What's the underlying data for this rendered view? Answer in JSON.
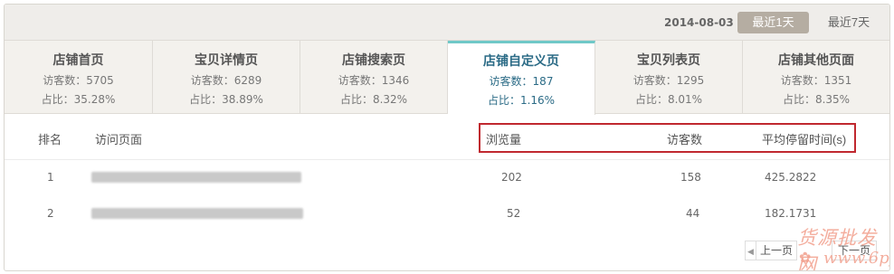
{
  "toolbar": {
    "date": "2014-08-03",
    "range_1day": "最近1天",
    "range_7day": "最近7天"
  },
  "tabs": [
    {
      "label": "店铺首页",
      "visitors": "访客数：5705",
      "ratio": "占比：35.28%",
      "active": false
    },
    {
      "label": "宝贝详情页",
      "visitors": "访客数：6289",
      "ratio": "占比：38.89%",
      "active": false
    },
    {
      "label": "店铺搜索页",
      "visitors": "访客数：1346",
      "ratio": "占比：8.32%",
      "active": false
    },
    {
      "label": "店铺自定义页",
      "visitors": "访客数：187",
      "ratio": "占比：1.16%",
      "active": true
    },
    {
      "label": "宝贝列表页",
      "visitors": "访客数：1295",
      "ratio": "占比：8.01%",
      "active": false
    },
    {
      "label": "店铺其他页面",
      "visitors": "访客数：1351",
      "ratio": "占比：8.35%",
      "active": false
    }
  ],
  "table": {
    "headers": {
      "rank": "排名",
      "page": "访问页面",
      "pageviews": "浏览量",
      "visitors": "访客数",
      "avg_time": "平均停留时间(s)"
    },
    "rows": [
      {
        "rank": "1",
        "pageviews": "202",
        "visitors": "158",
        "avg_time": "425.2822"
      },
      {
        "rank": "2",
        "pageviews": "52",
        "visitors": "44",
        "avg_time": "182.1731"
      }
    ]
  },
  "pager": {
    "prev": "上一页",
    "next": "下一页"
  },
  "watermark": {
    "line1": "货源批发网",
    "line2": "www.6pf.cn"
  },
  "colors": {
    "active_tab_accent": "#6fc8c7",
    "active_tab_text": "#2b6b86",
    "highlight_border": "#c0282f",
    "selected_range_bg": "#b5ada2"
  }
}
